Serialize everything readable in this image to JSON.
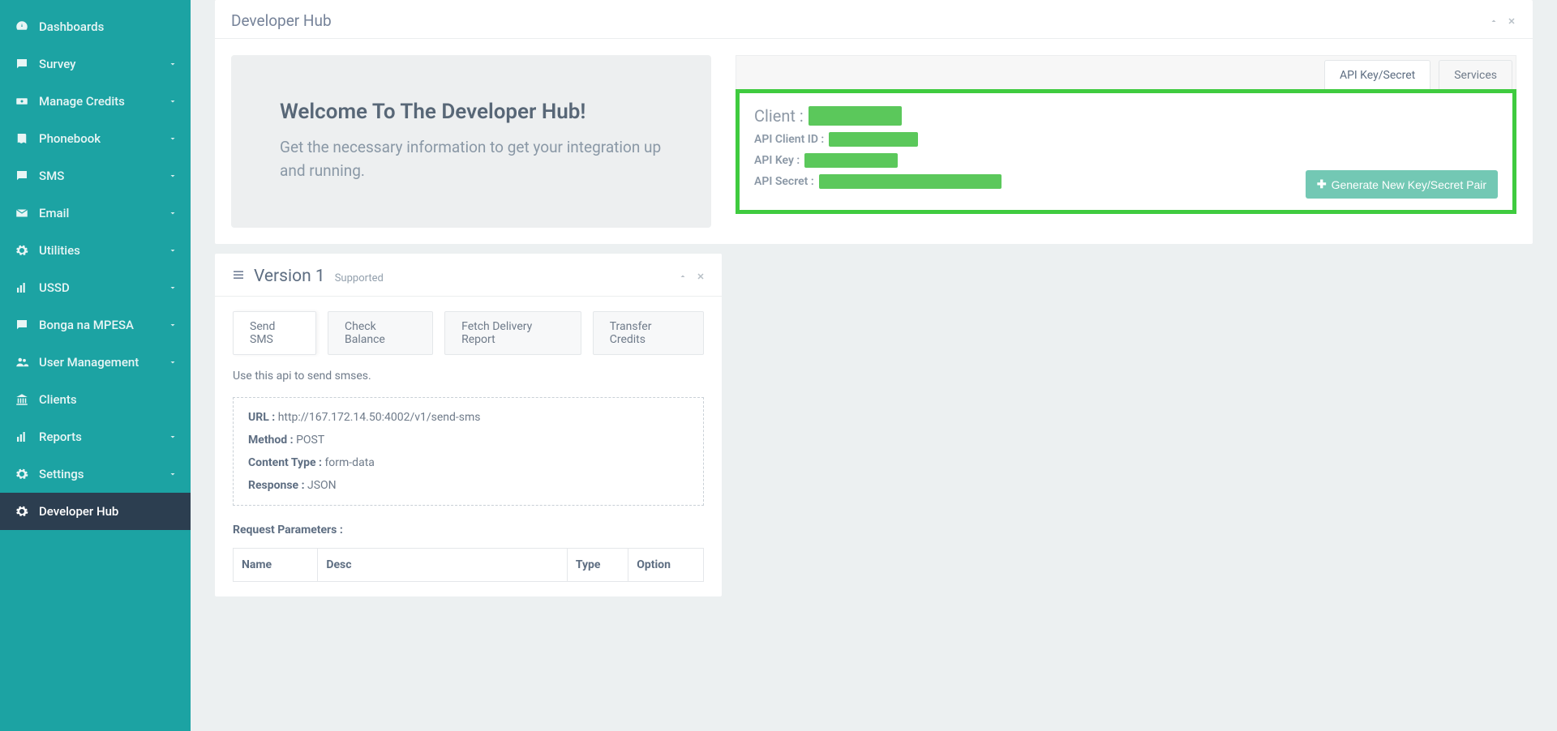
{
  "sidebar": {
    "items": [
      {
        "label": "Dashboards",
        "icon": "gauge",
        "chev": false
      },
      {
        "label": "Survey",
        "icon": "chat",
        "chev": true
      },
      {
        "label": "Manage Credits",
        "icon": "money",
        "chev": true
      },
      {
        "label": "Phonebook",
        "icon": "book",
        "chev": true
      },
      {
        "label": "SMS",
        "icon": "chat",
        "chev": true
      },
      {
        "label": "Email",
        "icon": "mail",
        "chev": true
      },
      {
        "label": "Utilities",
        "icon": "gear",
        "chev": true
      },
      {
        "label": "USSD",
        "icon": "bars",
        "chev": true
      },
      {
        "label": "Bonga na MPESA",
        "icon": "chat",
        "chev": true
      },
      {
        "label": "User Management",
        "icon": "users",
        "chev": true
      },
      {
        "label": "Clients",
        "icon": "bank",
        "chev": false
      },
      {
        "label": "Reports",
        "icon": "bars",
        "chev": true
      },
      {
        "label": "Settings",
        "icon": "gear",
        "chev": true
      },
      {
        "label": "Developer Hub",
        "icon": "gear",
        "chev": false,
        "active": true
      }
    ]
  },
  "hub": {
    "title": "Developer Hub",
    "welcome": {
      "heading": "Welcome To The Developer Hub!",
      "subtext": "Get the necessary information to get your integration up and running."
    },
    "tabs": {
      "api": "API Key/Secret",
      "services": "Services"
    },
    "creds": {
      "client_label": "Client :",
      "client_id_label": "API Client ID :",
      "key_label": "API Key :",
      "secret_label": "API Secret :",
      "generate_btn": "Generate New Key/Secret Pair"
    }
  },
  "version": {
    "title": "Version 1",
    "status": "Supported",
    "tabs": {
      "send_sms": "Send SMS",
      "check_balance": "Check Balance",
      "fetch_report": "Fetch Delivery Report",
      "transfer_credits": "Transfer Credits"
    },
    "intro": "Use this api to send smses.",
    "details": {
      "url_label": "URL :",
      "url_value": "http://167.172.14.50:4002/v1/send-sms",
      "method_label": "Method :",
      "method_value": "POST",
      "content_type_label": "Content Type :",
      "content_type_value": "form-data",
      "response_label": "Response :",
      "response_value": "JSON"
    },
    "request_params": {
      "heading": "Request Parameters :",
      "columns": {
        "name": "Name",
        "desc": "Desc",
        "type": "Type",
        "option": "Option"
      }
    }
  }
}
